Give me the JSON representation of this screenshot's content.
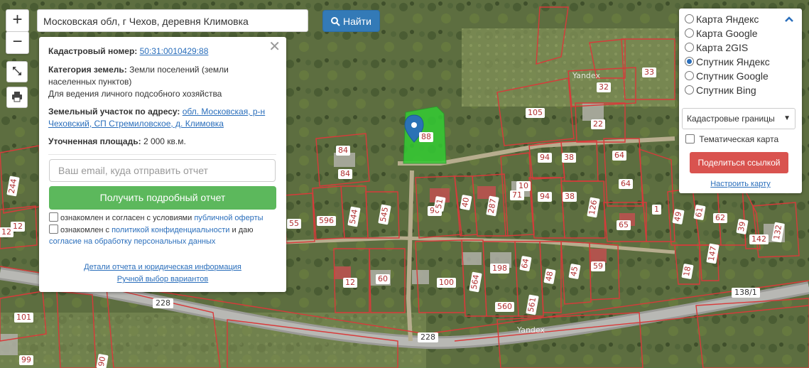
{
  "search": {
    "value": "Московская обл, г Чехов, деревня Климовка",
    "button_label": "Найти"
  },
  "controls": {
    "zoom_in": "+",
    "zoom_out": "−"
  },
  "popup": {
    "cadastral_number_label": "Кадастровый номер:",
    "cadastral_number": "50:31:0010429:88",
    "land_category_label": "Категория земель:",
    "land_category": "Земли поселений (земли населенных пунктов)",
    "land_use": "Для ведения личного подсобного хозяйства",
    "address_label": "Земельный участок по адресу:",
    "address": "обл. Московская, р-н Чеховский, СП Стремиловское, д. Климовка",
    "area_label": "Уточненная площадь:",
    "area": "2 000 кв.м.",
    "email_placeholder": "Ваш email, куда отправить отчет",
    "report_button": "Получить подробный отчет",
    "consent1_text": "ознакомлен и согласен с условиями",
    "consent1_link": "публичной оферты",
    "consent2_text_a": "ознакомлен с",
    "consent2_link_a": "политикой конфиденциальности",
    "consent2_text_b": "и даю",
    "consent2_link_b": "согласие на обработку персональных данных",
    "details_link": "Детали отчета и юридическая информация",
    "manual_link": "Ручной выбор вариантов"
  },
  "layers": {
    "options": [
      "Карта Яндекс",
      "Карта Google",
      "Карта 2GIS",
      "Спутник Яндекс",
      "Спутник Google",
      "Спутник Bing"
    ],
    "selected": "Спутник Яндекс",
    "overlay_select": "Кадастровые границы",
    "thematic_label": "Тематическая карта",
    "share_button": "Поделиться ссылкой",
    "settings_link": "Настроить карту"
  },
  "map": {
    "watermark": "Yandex",
    "road_labels": [
      "228",
      "228",
      "138/1"
    ],
    "plot_labels": [
      "88",
      "84",
      "84",
      "105",
      "32",
      "33",
      "22",
      "94",
      "38",
      "64",
      "94",
      "38",
      "64",
      "71",
      "10",
      "90",
      "51",
      "40",
      "287",
      "126",
      "1",
      "49",
      "61",
      "62",
      "39",
      "142",
      "132",
      "65",
      "596",
      "544",
      "545",
      "55",
      "12",
      "244",
      "12",
      "198",
      "100",
      "564",
      "560",
      "64",
      "561",
      "48",
      "45",
      "59",
      "147",
      "18",
      "60",
      "12",
      "101",
      "99",
      "90"
    ],
    "colors": {
      "selected_plot": "#33cc33",
      "boundary": "#d83a3a",
      "marker": "#2a72b5"
    }
  }
}
